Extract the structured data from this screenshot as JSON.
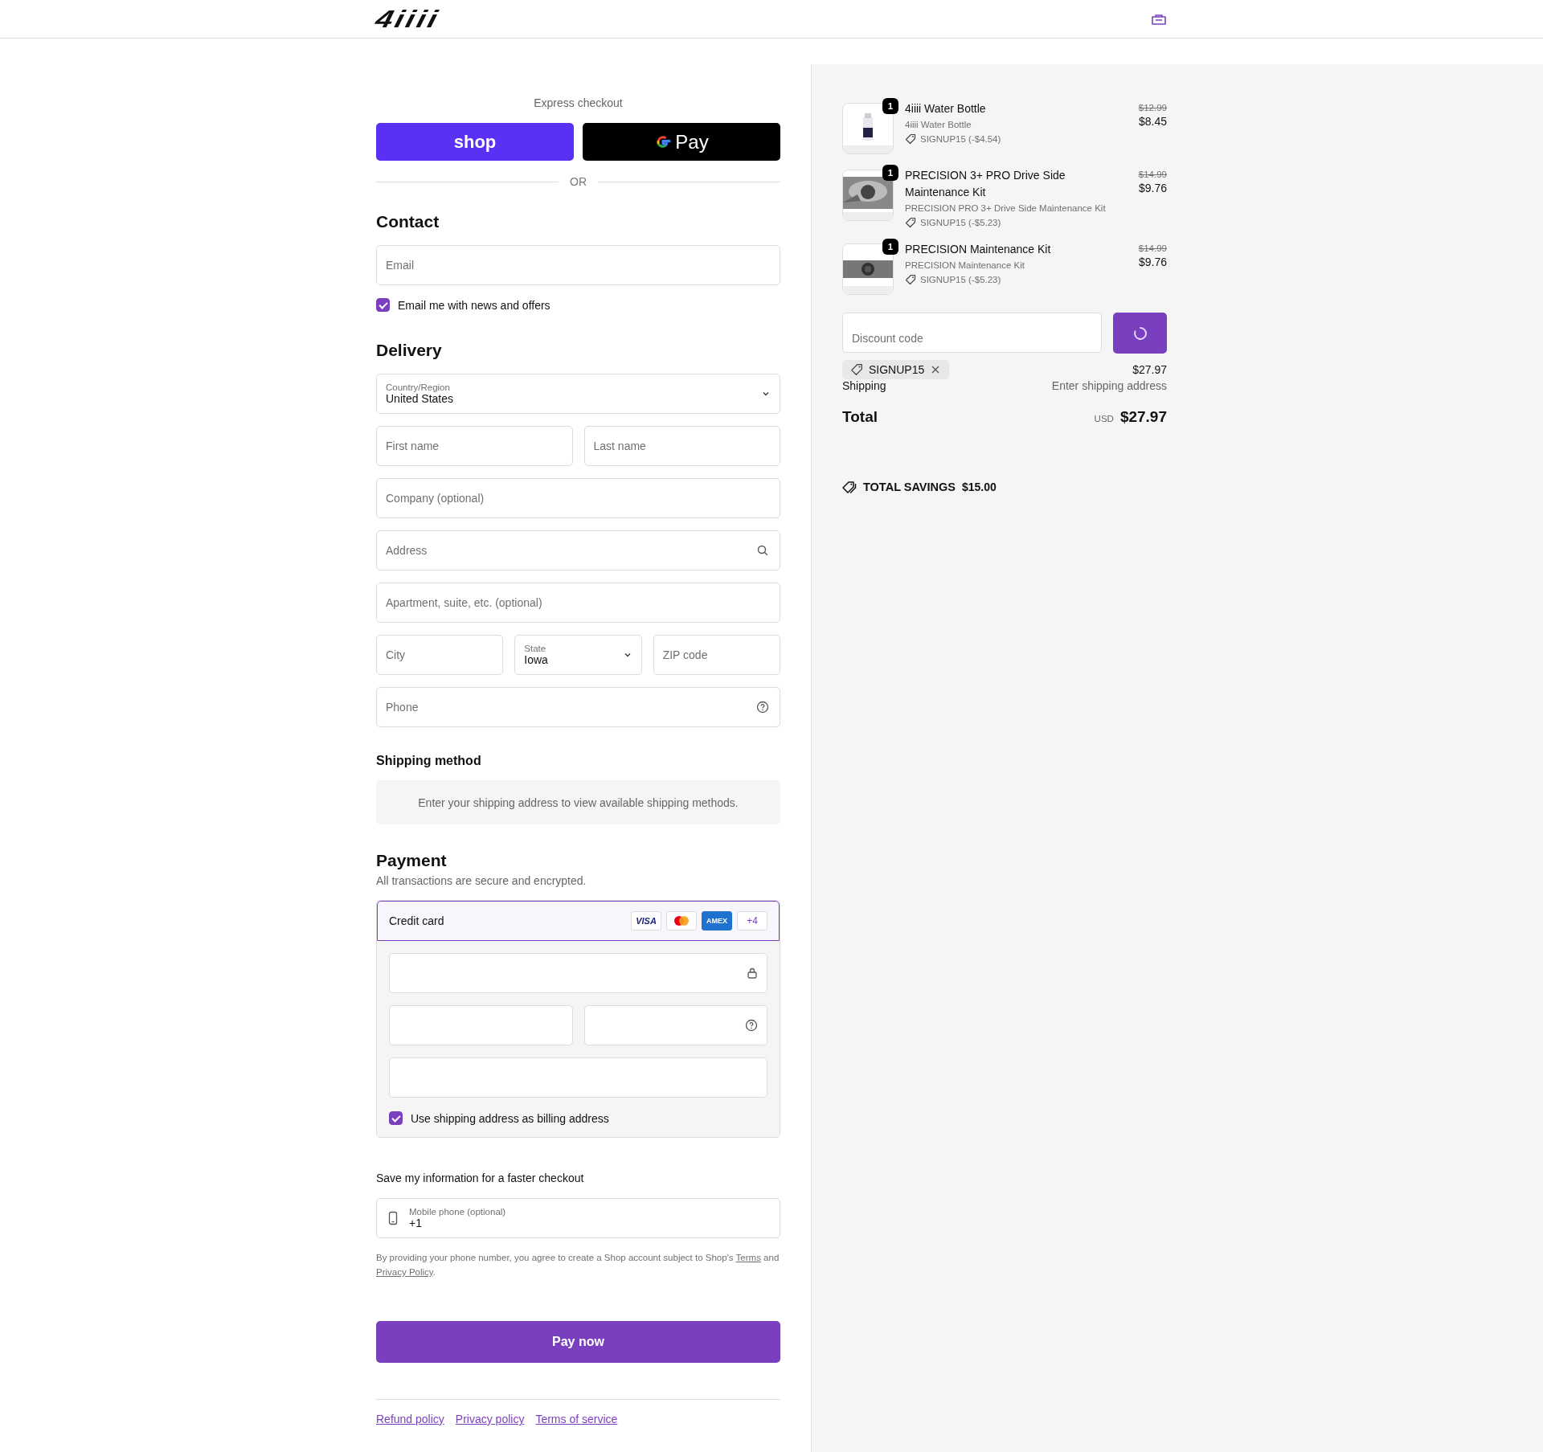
{
  "header": {
    "logo": "4iiii"
  },
  "express": {
    "title": "Express checkout",
    "buttons": [
      {
        "kind": "shop",
        "label": "shop"
      },
      {
        "kind": "gpay",
        "label": "Pay"
      }
    ],
    "divider_label": "OR"
  },
  "contact": {
    "heading": "Contact",
    "email": {
      "placeholder": "Email"
    },
    "newsletter": {
      "label": "Email me with news and offers",
      "checked": true
    }
  },
  "delivery": {
    "heading": "Delivery",
    "rows": [
      [
        {
          "kind": "select",
          "label": "Country/Region",
          "value": "United States"
        }
      ],
      [
        {
          "kind": "text",
          "placeholder": "First name"
        },
        {
          "kind": "text",
          "placeholder": "Last name"
        }
      ],
      [
        {
          "kind": "text",
          "placeholder": "Company (optional)"
        }
      ],
      [
        {
          "kind": "search",
          "placeholder": "Address"
        }
      ],
      [
        {
          "kind": "text",
          "placeholder": "Apartment, suite, etc. (optional)"
        }
      ],
      [
        {
          "kind": "text",
          "placeholder": "City"
        },
        {
          "kind": "select",
          "label": "State",
          "value": "Iowa"
        },
        {
          "kind": "text",
          "placeholder": "ZIP code"
        }
      ],
      [
        {
          "kind": "help",
          "placeholder": "Phone"
        }
      ]
    ]
  },
  "shipping_method": {
    "heading": "Shipping method",
    "notice": "Enter your shipping address to view available shipping methods."
  },
  "payment": {
    "heading": "Payment",
    "subtitle": "All transactions are secure and encrypted.",
    "method": {
      "label": "Credit card",
      "selected": true,
      "brands": [
        {
          "kind": "visa",
          "label": "VISA"
        },
        {
          "kind": "mastercard"
        },
        {
          "kind": "amex",
          "label": "AMEX"
        },
        {
          "kind": "more",
          "label": "+4"
        }
      ]
    },
    "card_rows": [
      [
        {
          "kind": "lock"
        }
      ],
      [
        {
          "kind": "text"
        },
        {
          "kind": "help"
        }
      ],
      [
        {
          "kind": "text"
        }
      ]
    ],
    "billing": {
      "label": "Use shipping address as billing address",
      "checked": true
    }
  },
  "save_info": {
    "heading": "Save my information for a faster checkout",
    "phone": {
      "label": "Mobile phone (optional)",
      "value": "+1"
    },
    "legal": [
      {
        "kind": "text",
        "text": "By providing your phone number, you agree to create a Shop account subject to Shop's "
      },
      {
        "kind": "link",
        "text": "Terms"
      },
      {
        "kind": "text",
        "text": " and "
      },
      {
        "kind": "link",
        "text": "Privacy Policy"
      },
      {
        "kind": "text",
        "text": "."
      }
    ]
  },
  "pay_button": "Pay now",
  "footer_links": [
    "Refund policy",
    "Privacy policy",
    "Terms of service"
  ],
  "summary": {
    "items": [
      {
        "name": "4iiii Water Bottle",
        "variant": "4iiii Water Bottle",
        "discount": "SIGNUP15 (-$4.54)",
        "quantity": "1",
        "original_price": "$12.99",
        "price": "$8.45"
      },
      {
        "name": "PRECISION 3+ PRO Drive Side Maintenance Kit",
        "variant": "PRECISION PRO 3+ Drive Side Maintenance Kit",
        "discount": "SIGNUP15 (-$5.23)",
        "quantity": "1",
        "original_price": "$14.99",
        "price": "$9.76"
      },
      {
        "name": "PRECISION Maintenance Kit",
        "variant": "PRECISION Maintenance Kit",
        "discount": "SIGNUP15 (-$5.23)",
        "quantity": "1",
        "original_price": "$14.99",
        "price": "$9.76"
      }
    ],
    "discount": {
      "placeholder": "Discount code",
      "applied_code": "SIGNUP15"
    },
    "subtotal_value": "$27.97",
    "shipping": {
      "label": "Shipping",
      "value": "Enter shipping address"
    },
    "total": {
      "label": "Total",
      "currency": "USD",
      "value": "$27.97"
    },
    "savings": {
      "label": "TOTAL SAVINGS",
      "value": "$15.00"
    }
  }
}
